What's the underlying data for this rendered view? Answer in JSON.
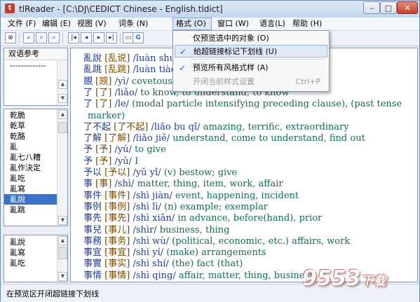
{
  "window": {
    "title": "tlReader - [C:\\DJ\\CEDICT Chinese - English.tldict]"
  },
  "menu": [
    "文件 (F)",
    "编辑 (E)",
    "视图 (V)",
    "词条 (N)",
    "格式 (O)",
    "窗口 (W)",
    "语言(L)",
    "帮助 (H)"
  ],
  "format_menu": {
    "items": [
      {
        "label": "仅预览选中的对象 (O)",
        "checked": false,
        "disabled": false,
        "highlight": false,
        "shortcut": ""
      },
      {
        "label": "給超链接标记下划线 (U)",
        "checked": true,
        "disabled": false,
        "highlight": true,
        "shortcut": ""
      },
      {
        "label": "预览所有风格式样 (A)",
        "checked": true,
        "disabled": false,
        "highlight": false,
        "shortcut": ""
      },
      {
        "label": "开闭当前样式设置",
        "checked": false,
        "disabled": true,
        "highlight": false,
        "shortcut": "Ctrl+P"
      }
    ]
  },
  "panel_top": {
    "header": "双语参考",
    "dashes": "-------------"
  },
  "panel_mid": {
    "items": [
      "乾脆",
      "乾草",
      "乾酪",
      "亂",
      "亂七八糟",
      "亂作決定",
      "亂吃",
      "亂寫",
      "亂說",
      "亂跳"
    ],
    "selected_index": 8
  },
  "panel_bottom": {
    "items": [
      "亂說",
      "亂寫",
      "亂吃"
    ],
    "selected_index": -1
  },
  "entries": [
    {
      "hz": "亂說",
      "tr": "[乱说]",
      "py": "/luàn shuō/",
      "df": ""
    },
    {
      "hz": "亂跳",
      "tr": "[乱跳]",
      "py": "/luàn tiào/",
      "df": ""
    },
    {
      "hz": "覬",
      "tr": "[觊]",
      "py": "/yì/",
      "df": "covetous"
    },
    {
      "hz": "了",
      "tr": "[了]",
      "py": "/liǎo/",
      "df": "to know, to understand, to know"
    },
    {
      "hz": "了",
      "tr": "[了]",
      "py": "/le/",
      "df": "(modal particle intensifying preceding clause), (past tense"
    },
    {
      "hz": "",
      "tr": "",
      "py": "",
      "df": "marker)"
    },
    {
      "hz": "了不起",
      "tr": "[了不起]",
      "py": "/liǎo bu qǐ/",
      "df": "amazing, terrific, extraordinary"
    },
    {
      "hz": "了解",
      "tr": "[了解]",
      "py": "/liǎo jiě/",
      "df": "understand, come to understand, find out"
    },
    {
      "hz": "予",
      "tr": "[予]",
      "py": "/yú/",
      "df": "to give"
    },
    {
      "hz": "予",
      "tr": "[予]",
      "py": "/yǔ/",
      "df": "I"
    },
    {
      "hz": "予以",
      "tr": "[予以]",
      "py": "/yǔ yǐ/",
      "df": "(v) bestow; give"
    },
    {
      "hz": "事",
      "tr": "[事]",
      "py": "/shì/",
      "df": "matter, thing, item, work, affair"
    },
    {
      "hz": "事件",
      "tr": "[事件]",
      "py": "/shì jiàn/",
      "df": "event, happening, incident"
    },
    {
      "hz": "事例",
      "tr": "[事例]",
      "py": "/shì lì/",
      "df": "(n) example; exemplar"
    },
    {
      "hz": "事先",
      "tr": "[事先]",
      "py": "/shì xiān/",
      "df": "in advance, before(hand), prior"
    },
    {
      "hz": "事兒",
      "tr": "[事儿]",
      "py": "/shìr/",
      "df": "business, thing"
    },
    {
      "hz": "事務",
      "tr": "[事务]",
      "py": "/shì wù/",
      "df": "(political, economic, etc.) affairs, work"
    },
    {
      "hz": "事宜",
      "tr": "[事宜]",
      "py": "/shì yí/",
      "df": "(make) arrangements"
    },
    {
      "hz": "事實",
      "tr": "[事实]",
      "py": "/shì shí/",
      "df": "(the) fact (that)"
    },
    {
      "hz": "事情",
      "tr": "[事情]",
      "py": "/shì qing/",
      "df": "affair, matter, thing, business"
    }
  ],
  "toolbar_icons": [
    "binoculars-icon",
    "search-icon",
    "search-prev-icon",
    "search-next-icon",
    "first-icon",
    "prev-icon",
    "next-icon",
    "last-icon",
    "copy-icon",
    "paste-icon",
    "google-icon"
  ],
  "status": {
    "text": "在预览区开闭超链接下划线"
  },
  "watermark": "9553下载"
}
